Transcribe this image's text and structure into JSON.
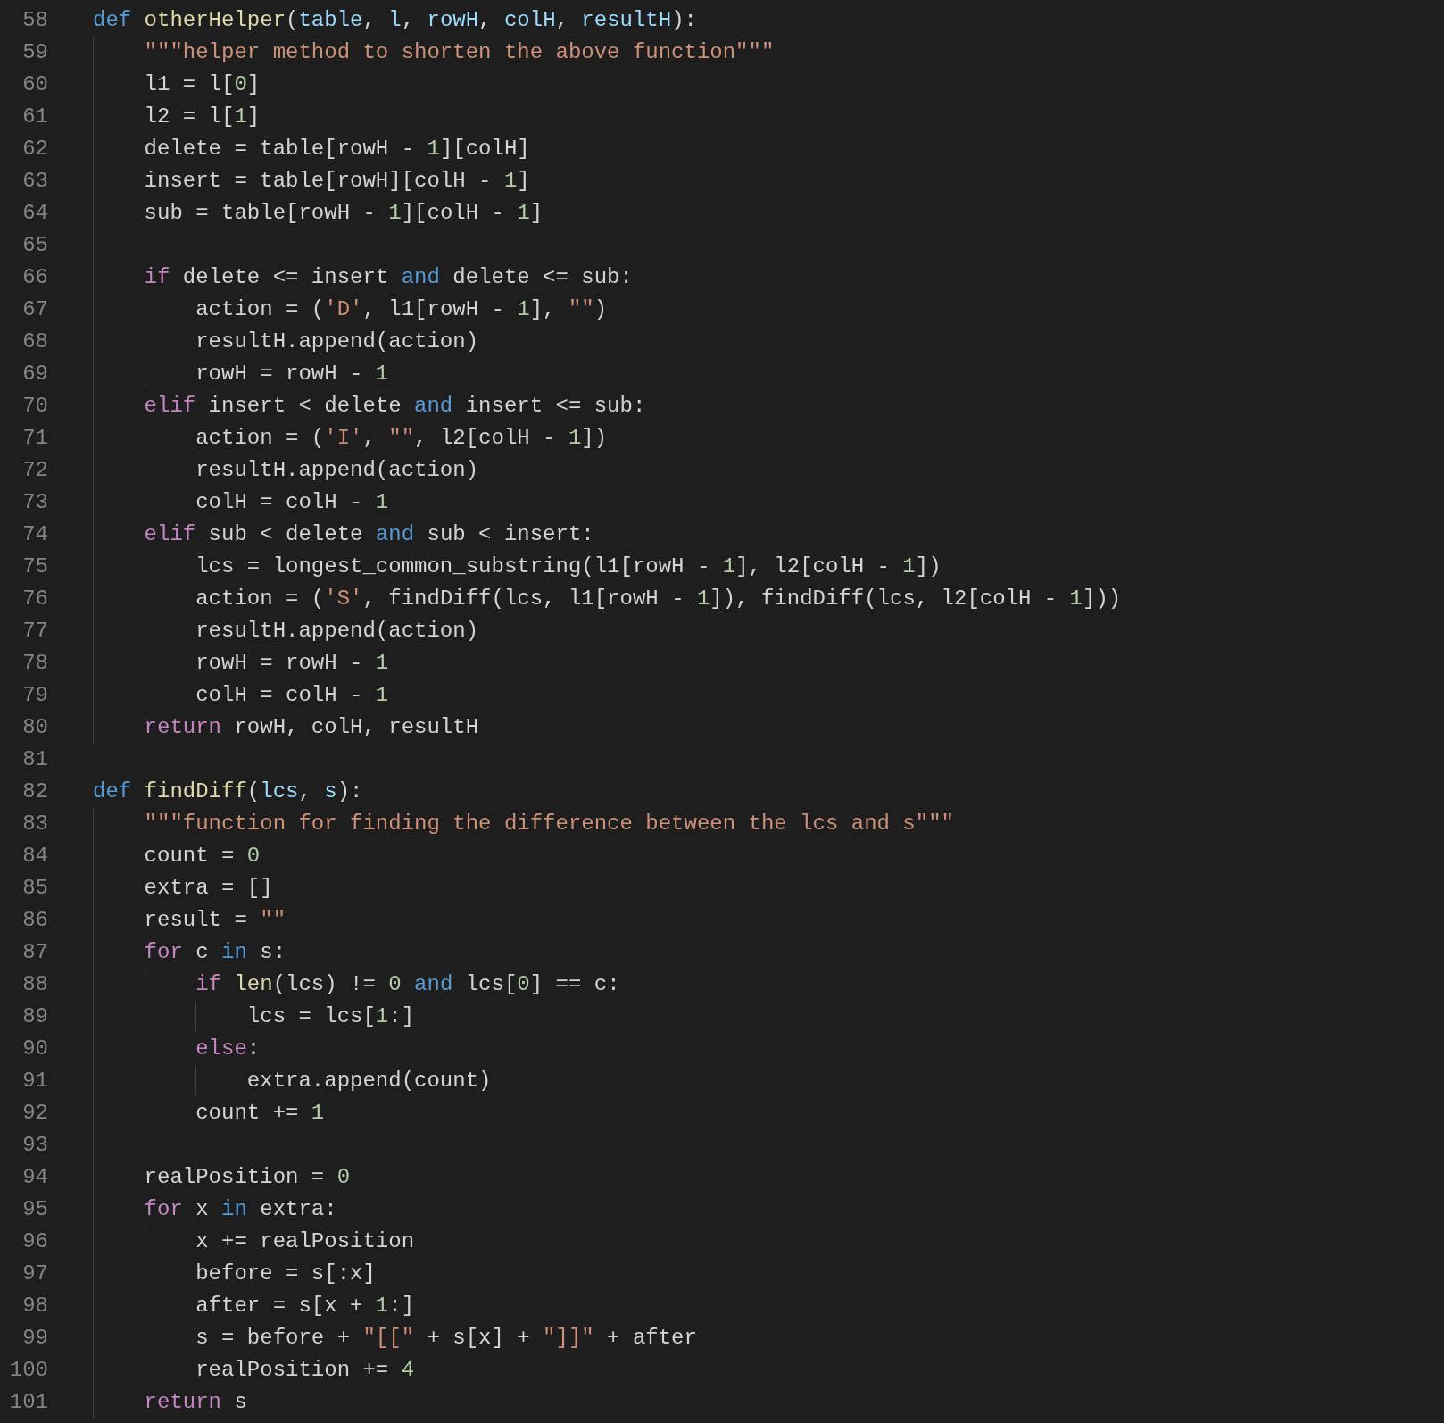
{
  "editor": {
    "lines": [
      {
        "number": "58",
        "tokens": [
          {
            "kind": "keyword",
            "text": "def "
          },
          {
            "kind": "function",
            "text": "otherHelper"
          },
          {
            "kind": "plain",
            "text": "("
          },
          {
            "kind": "parameter",
            "text": "table"
          },
          {
            "kind": "plain",
            "text": ", "
          },
          {
            "kind": "parameter",
            "text": "l"
          },
          {
            "kind": "plain",
            "text": ", "
          },
          {
            "kind": "parameter",
            "text": "rowH"
          },
          {
            "kind": "plain",
            "text": ", "
          },
          {
            "kind": "parameter",
            "text": "colH"
          },
          {
            "kind": "plain",
            "text": ", "
          },
          {
            "kind": "parameter",
            "text": "resultH"
          },
          {
            "kind": "plain",
            "text": "):"
          }
        ],
        "children": [
          {
            "number": "59",
            "tokens": [
              {
                "kind": "string",
                "text": "\"\"\"helper method to shorten the above function\"\"\""
              }
            ]
          },
          {
            "number": "60",
            "tokens": [
              {
                "kind": "plain",
                "text": "l1 = l["
              },
              {
                "kind": "number",
                "text": "0"
              },
              {
                "kind": "plain",
                "text": "]"
              }
            ]
          },
          {
            "number": "61",
            "tokens": [
              {
                "kind": "plain",
                "text": "l2 = l["
              },
              {
                "kind": "number",
                "text": "1"
              },
              {
                "kind": "plain",
                "text": "]"
              }
            ]
          },
          {
            "number": "62",
            "tokens": [
              {
                "kind": "plain",
                "text": "delete = table[rowH - "
              },
              {
                "kind": "number",
                "text": "1"
              },
              {
                "kind": "plain",
                "text": "][colH]"
              }
            ]
          },
          {
            "number": "63",
            "tokens": [
              {
                "kind": "plain",
                "text": "insert = table[rowH][colH - "
              },
              {
                "kind": "number",
                "text": "1"
              },
              {
                "kind": "plain",
                "text": "]"
              }
            ]
          },
          {
            "number": "64",
            "tokens": [
              {
                "kind": "plain",
                "text": "sub = table[rowH - "
              },
              {
                "kind": "number",
                "text": "1"
              },
              {
                "kind": "plain",
                "text": "][colH - "
              },
              {
                "kind": "number",
                "text": "1"
              },
              {
                "kind": "plain",
                "text": "]"
              }
            ]
          },
          {
            "number": "65"
          },
          {
            "number": "66",
            "tokens": [
              {
                "kind": "control",
                "text": "if"
              },
              {
                "kind": "plain",
                "text": " delete <= insert "
              },
              {
                "kind": "keyword",
                "text": "and"
              },
              {
                "kind": "plain",
                "text": " delete <= sub:"
              }
            ],
            "children": [
              {
                "number": "67",
                "tokens": [
                  {
                    "kind": "plain",
                    "text": "action = ("
                  },
                  {
                    "kind": "string",
                    "text": "'D'"
                  },
                  {
                    "kind": "plain",
                    "text": ", l1[rowH - "
                  },
                  {
                    "kind": "number",
                    "text": "1"
                  },
                  {
                    "kind": "plain",
                    "text": "], "
                  },
                  {
                    "kind": "string",
                    "text": "\"\""
                  },
                  {
                    "kind": "plain",
                    "text": ")"
                  }
                ]
              },
              {
                "number": "68",
                "tokens": [
                  {
                    "kind": "plain",
                    "text": "resultH.append(action)"
                  }
                ]
              },
              {
                "number": "69",
                "tokens": [
                  {
                    "kind": "plain",
                    "text": "rowH = rowH - "
                  },
                  {
                    "kind": "number",
                    "text": "1"
                  }
                ]
              }
            ]
          },
          {
            "number": "70",
            "tokens": [
              {
                "kind": "control",
                "text": "elif"
              },
              {
                "kind": "plain",
                "text": " insert < delete "
              },
              {
                "kind": "keyword",
                "text": "and"
              },
              {
                "kind": "plain",
                "text": " insert <= sub:"
              }
            ],
            "children": [
              {
                "number": "71",
                "tokens": [
                  {
                    "kind": "plain",
                    "text": "action = ("
                  },
                  {
                    "kind": "string",
                    "text": "'I'"
                  },
                  {
                    "kind": "plain",
                    "text": ", "
                  },
                  {
                    "kind": "string",
                    "text": "\"\""
                  },
                  {
                    "kind": "plain",
                    "text": ", l2[colH - "
                  },
                  {
                    "kind": "number",
                    "text": "1"
                  },
                  {
                    "kind": "plain",
                    "text": "])"
                  }
                ]
              },
              {
                "number": "72",
                "tokens": [
                  {
                    "kind": "plain",
                    "text": "resultH.append(action)"
                  }
                ]
              },
              {
                "number": "73",
                "tokens": [
                  {
                    "kind": "plain",
                    "text": "colH = colH - "
                  },
                  {
                    "kind": "number",
                    "text": "1"
                  }
                ]
              }
            ]
          },
          {
            "number": "74",
            "tokens": [
              {
                "kind": "control",
                "text": "elif"
              },
              {
                "kind": "plain",
                "text": " sub < delete "
              },
              {
                "kind": "keyword",
                "text": "and"
              },
              {
                "kind": "plain",
                "text": " sub < insert:"
              }
            ],
            "children": [
              {
                "number": "75",
                "tokens": [
                  {
                    "kind": "plain",
                    "text": "lcs = longest_common_substring(l1[rowH - "
                  },
                  {
                    "kind": "number",
                    "text": "1"
                  },
                  {
                    "kind": "plain",
                    "text": "], l2[colH - "
                  },
                  {
                    "kind": "number",
                    "text": "1"
                  },
                  {
                    "kind": "plain",
                    "text": "])"
                  }
                ]
              },
              {
                "number": "76",
                "tokens": [
                  {
                    "kind": "plain",
                    "text": "action = ("
                  },
                  {
                    "kind": "string",
                    "text": "'S'"
                  },
                  {
                    "kind": "plain",
                    "text": ", findDiff(lcs, l1[rowH - "
                  },
                  {
                    "kind": "number",
                    "text": "1"
                  },
                  {
                    "kind": "plain",
                    "text": "]), findDiff(lcs, l2[colH - "
                  },
                  {
                    "kind": "number",
                    "text": "1"
                  },
                  {
                    "kind": "plain",
                    "text": "]))"
                  }
                ]
              },
              {
                "number": "77",
                "tokens": [
                  {
                    "kind": "plain",
                    "text": "resultH.append(action)"
                  }
                ]
              },
              {
                "number": "78",
                "tokens": [
                  {
                    "kind": "plain",
                    "text": "rowH = rowH - "
                  },
                  {
                    "kind": "number",
                    "text": "1"
                  }
                ]
              },
              {
                "number": "79",
                "tokens": [
                  {
                    "kind": "plain",
                    "text": "colH = colH - "
                  },
                  {
                    "kind": "number",
                    "text": "1"
                  }
                ]
              }
            ]
          },
          {
            "number": "80",
            "tokens": [
              {
                "kind": "control",
                "text": "return"
              },
              {
                "kind": "plain",
                "text": " rowH, colH, resultH"
              }
            ]
          }
        ]
      },
      {
        "number": "81"
      },
      {
        "number": "82",
        "tokens": [
          {
            "kind": "keyword",
            "text": "def "
          },
          {
            "kind": "function",
            "text": "findDiff"
          },
          {
            "kind": "plain",
            "text": "("
          },
          {
            "kind": "parameter",
            "text": "lcs"
          },
          {
            "kind": "plain",
            "text": ", "
          },
          {
            "kind": "parameter",
            "text": "s"
          },
          {
            "kind": "plain",
            "text": "):"
          }
        ],
        "children": [
          {
            "number": "83",
            "tokens": [
              {
                "kind": "string",
                "text": "\"\"\"function for finding the difference between the lcs and s\"\"\""
              }
            ]
          },
          {
            "number": "84",
            "tokens": [
              {
                "kind": "plain",
                "text": "count = "
              },
              {
                "kind": "number",
                "text": "0"
              }
            ]
          },
          {
            "number": "85",
            "tokens": [
              {
                "kind": "plain",
                "text": "extra = []"
              }
            ]
          },
          {
            "number": "86",
            "tokens": [
              {
                "kind": "plain",
                "text": "result = "
              },
              {
                "kind": "string",
                "text": "\"\""
              }
            ]
          },
          {
            "number": "87",
            "tokens": [
              {
                "kind": "control",
                "text": "for"
              },
              {
                "kind": "plain",
                "text": " c "
              },
              {
                "kind": "keyword",
                "text": "in"
              },
              {
                "kind": "plain",
                "text": " s:"
              }
            ],
            "children": [
              {
                "number": "88",
                "tokens": [
                  {
                    "kind": "control",
                    "text": "if "
                  },
                  {
                    "kind": "function",
                    "text": "len"
                  },
                  {
                    "kind": "plain",
                    "text": "(lcs) != "
                  },
                  {
                    "kind": "number",
                    "text": "0"
                  },
                  {
                    "kind": "keyword",
                    "text": " and"
                  },
                  {
                    "kind": "plain",
                    "text": " lcs["
                  },
                  {
                    "kind": "number",
                    "text": "0"
                  },
                  {
                    "kind": "plain",
                    "text": "] == c:"
                  }
                ],
                "children": [
                  {
                    "number": "89",
                    "tokens": [
                      {
                        "kind": "plain",
                        "text": "lcs = lcs["
                      },
                      {
                        "kind": "number",
                        "text": "1"
                      },
                      {
                        "kind": "plain",
                        "text": ":]"
                      }
                    ]
                  }
                ]
              },
              {
                "number": "90",
                "tokens": [
                  {
                    "kind": "control",
                    "text": "else"
                  },
                  {
                    "kind": "plain",
                    "text": ":"
                  }
                ],
                "children": [
                  {
                    "number": "91",
                    "tokens": [
                      {
                        "kind": "plain",
                        "text": "extra.append(count)"
                      }
                    ]
                  }
                ]
              },
              {
                "number": "92",
                "tokens": [
                  {
                    "kind": "plain",
                    "text": "count += "
                  },
                  {
                    "kind": "number",
                    "text": "1"
                  }
                ]
              }
            ]
          },
          {
            "number": "93"
          },
          {
            "number": "94",
            "tokens": [
              {
                "kind": "plain",
                "text": "realPosition = "
              },
              {
                "kind": "number",
                "text": "0"
              }
            ]
          },
          {
            "number": "95",
            "tokens": [
              {
                "kind": "control",
                "text": "for"
              },
              {
                "kind": "plain",
                "text": " x "
              },
              {
                "kind": "keyword",
                "text": "in"
              },
              {
                "kind": "plain",
                "text": " extra:"
              }
            ],
            "children": [
              {
                "number": "96",
                "tokens": [
                  {
                    "kind": "plain",
                    "text": "x += realPosition"
                  }
                ]
              },
              {
                "number": "97",
                "tokens": [
                  {
                    "kind": "plain",
                    "text": "before = s[:x]"
                  }
                ]
              },
              {
                "number": "98",
                "tokens": [
                  {
                    "kind": "plain",
                    "text": "after = s[x + "
                  },
                  {
                    "kind": "number",
                    "text": "1"
                  },
                  {
                    "kind": "plain",
                    "text": ":]"
                  }
                ]
              },
              {
                "number": "99",
                "tokens": [
                  {
                    "kind": "plain",
                    "text": "s = before + "
                  },
                  {
                    "kind": "string",
                    "text": "\"[[\""
                  },
                  {
                    "kind": "plain",
                    "text": " + s[x] + "
                  },
                  {
                    "kind": "string",
                    "text": "\"]]\""
                  },
                  {
                    "kind": "plain",
                    "text": " + after"
                  }
                ]
              },
              {
                "number": "100",
                "tokens": [
                  {
                    "kind": "plain",
                    "text": "realPosition += "
                  },
                  {
                    "kind": "number",
                    "text": "4"
                  }
                ]
              }
            ]
          },
          {
            "number": "101",
            "tokens": [
              {
                "kind": "control",
                "text": "return"
              },
              {
                "kind": "plain",
                "text": " s"
              }
            ]
          }
        ]
      }
    ]
  }
}
